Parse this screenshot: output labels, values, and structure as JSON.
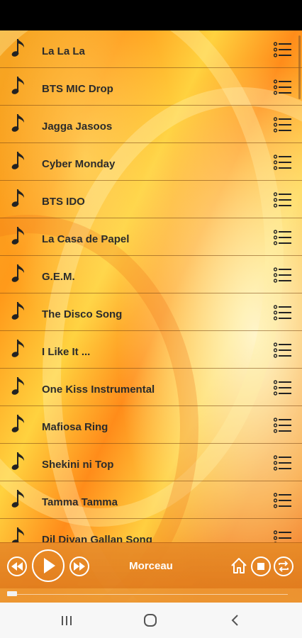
{
  "playlist": {
    "items": [
      {
        "title": "La La La"
      },
      {
        "title": "BTS MIC Drop"
      },
      {
        "title": "Jagga Jasoos"
      },
      {
        "title": "Cyber Monday"
      },
      {
        "title": "BTS IDO"
      },
      {
        "title": "La Casa de Papel"
      },
      {
        "title": "G.E.M."
      },
      {
        "title": "The Disco Song"
      },
      {
        "title": "I Like It ..."
      },
      {
        "title": "One Kiss Instrumental"
      },
      {
        "title": "Mafiosa Ring"
      },
      {
        "title": "Shekini ni Top"
      },
      {
        "title": "Tamma Tamma"
      },
      {
        "title": "Dil Diyan Gallan Song"
      }
    ],
    "item_icon": "music-note-icon",
    "item_action_icon": "list-menu-icon"
  },
  "player": {
    "current_label": "Morceau",
    "icons": [
      "rewind-icon",
      "play-icon",
      "fast-forward-icon",
      "home-icon",
      "stop-icon",
      "repeat-icon"
    ],
    "progress": 0
  },
  "system_nav": {
    "icons": [
      "recents-icon",
      "home-circle-icon",
      "back-icon"
    ]
  },
  "colors": {
    "title_text": "#2b2b2b",
    "player_bar": "#e88c28",
    "nav_bar": "#f7f7f7"
  }
}
